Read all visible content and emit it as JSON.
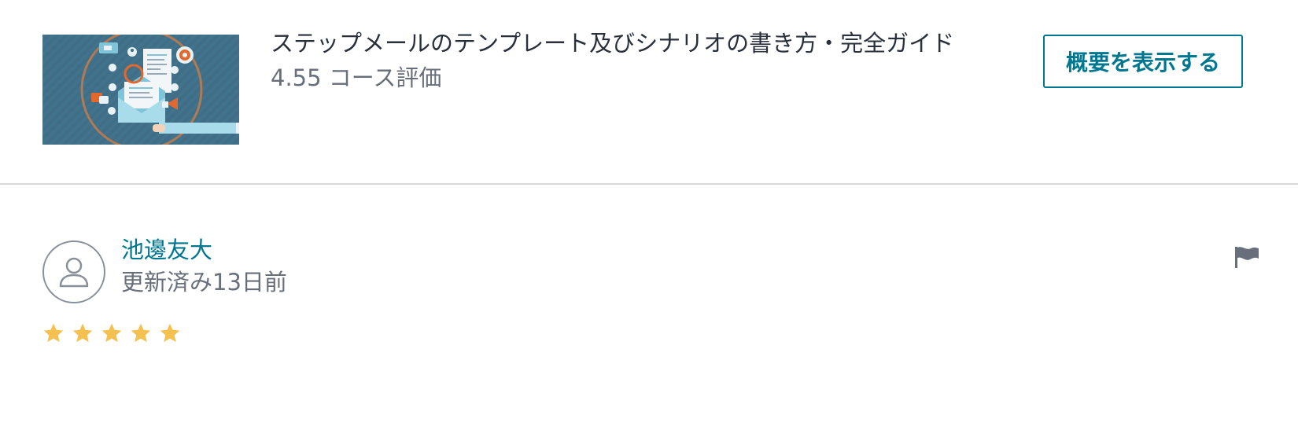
{
  "course": {
    "thumbnail_icon": "email-marketing-illustration",
    "title": "ステップメールのテンプレート及びシナリオの書き方・完全ガイド",
    "rating_text": "4.55 コース評価",
    "view_button_label": "概要を表示する"
  },
  "review": {
    "avatar_icon": "user-icon",
    "reviewer_name": "池邊友大",
    "updated_text": "更新済み13日前",
    "flag_icon": "flag-icon",
    "rating": 5,
    "rating_max": 5
  },
  "colors": {
    "accent": "#007791",
    "star": "#f4c150",
    "text_primary": "#29303b",
    "text_secondary": "#686f7a",
    "divider": "#d8d9db"
  }
}
